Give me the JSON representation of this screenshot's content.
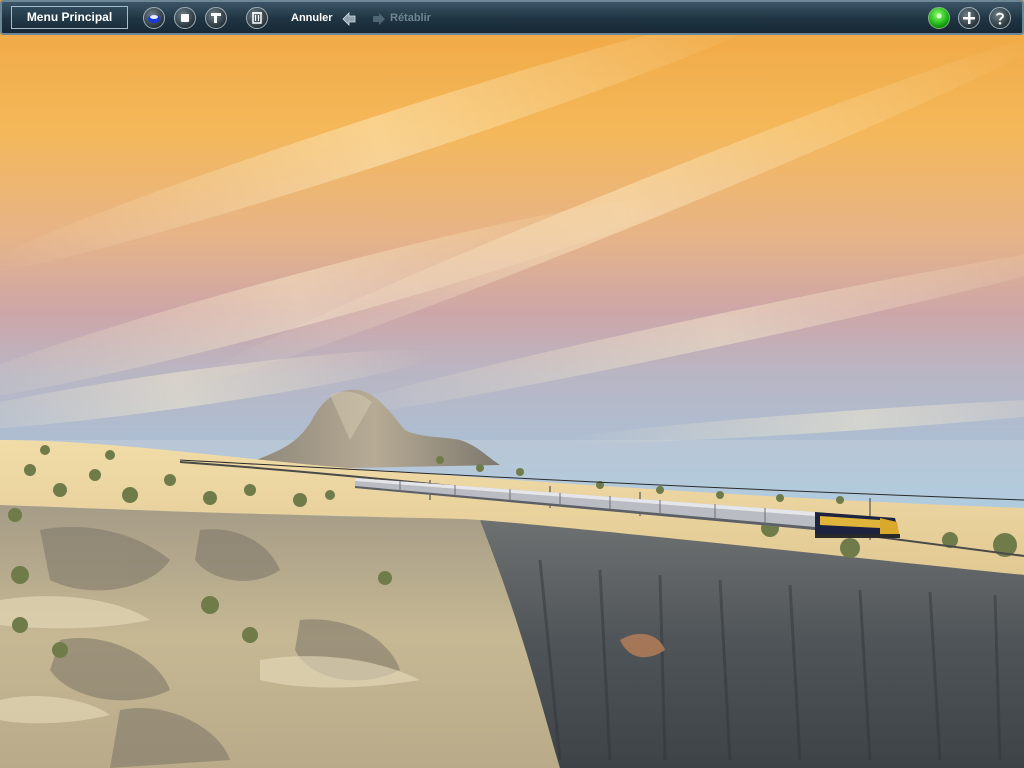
{
  "toolbar": {
    "main_menu_label": "Menu Principal",
    "undo_label": "Annuler",
    "redo_label": "Rétablir"
  },
  "icons": {
    "layers": "layers-icon",
    "stop": "stop-icon",
    "tools": "tools-icon",
    "delete": "trash-icon",
    "undo": "arrow-left-icon",
    "redo": "arrow-right-icon",
    "status": "green-light-icon",
    "add": "plus-icon",
    "help": "question-icon"
  },
  "colors": {
    "toolbar_bg": "#1f3442",
    "toolbar_border": "#6e8796",
    "text_active": "#ffffff",
    "text_disabled": "#6f8592",
    "status_green": "#20b61a"
  }
}
